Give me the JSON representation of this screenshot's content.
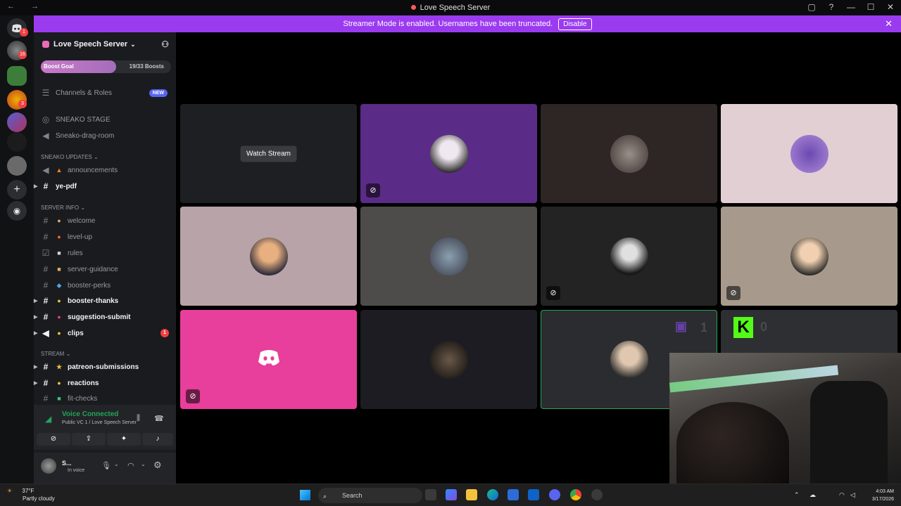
{
  "window": {
    "title": "Love Speech Server",
    "controls": [
      "▢",
      "?",
      "—",
      "☐",
      "✕"
    ]
  },
  "banner": {
    "text": "Streamer Mode is enabled. Usernames have been truncated.",
    "button_label": "Disable",
    "close_glyph": "✕"
  },
  "rail": {
    "badges": [
      "1",
      "16",
      "3"
    ]
  },
  "server": {
    "name": "Love Speech Server",
    "boost_label": "Boost Goal",
    "boost_count": "19/33 Boosts",
    "boost_progress": 0.58
  },
  "sidebar": {
    "channels_roles": "Channels & Roles",
    "new_badge": "NEW",
    "stage_name": "SNEAKO STAGE",
    "drag_room": "Sneako-drag-room",
    "cat_updates": "SNEAKO UPDATES",
    "announcements": "announcements",
    "ye_pdf": "ye-pdf",
    "cat_server_info": "SERVER INFO",
    "welcome": "welcome",
    "level_up": "level-up",
    "rules": "rules",
    "server_guidance": "server-guidance",
    "booster_perks": "booster-perks",
    "booster_thanks": "booster-thanks",
    "suggestion_submit": "suggestion-submit",
    "clips": "clips",
    "clips_unread": "1",
    "cat_stream": "STREAM",
    "patreon": "patreon-submissions",
    "reactions": "reactions",
    "fit_checks": "fit-checks"
  },
  "voice": {
    "status": "Voice Connected",
    "channel": "Public VC 1 / Love Speech Server"
  },
  "user": {
    "name": "S...",
    "status": "In voice"
  },
  "stage": {
    "watch_label": "Watch Stream",
    "tile_counts": [
      "1",
      "0"
    ]
  },
  "taskbar": {
    "temp": "37°F",
    "weather": "Partly cloudy",
    "search_placeholder": "Search",
    "time": "4:03 AM",
    "date": "3/17/2026"
  },
  "colors": {
    "accent": "#9b3bf0",
    "tile_purple": "#5b2c87",
    "tile_pink": "#e83e9c",
    "tile_lavender": "#e2cfd3",
    "tile_mauve": "#b8a3a8",
    "tile_taupe": "#a79a8c",
    "active_border": "#23a55a"
  }
}
